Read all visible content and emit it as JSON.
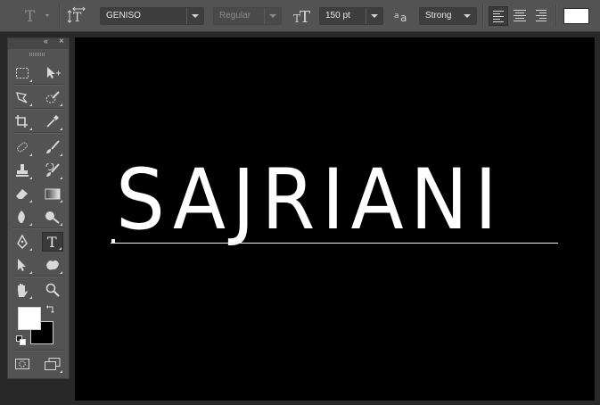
{
  "options_bar": {
    "tool_icon": "type-tool-icon",
    "orientation_icon": "text-orientation-icon",
    "font_family": "GENISO",
    "font_style": "Regular",
    "size_icon": "font-size-icon",
    "font_size": "150 pt",
    "aa_icon": "anti-alias-icon",
    "anti_alias": "Strong",
    "alignment": [
      "left",
      "center",
      "right"
    ],
    "active_alignment": "left",
    "text_color": "#ffffff"
  },
  "tools_panel": {
    "tools": [
      "rectangular-marquee-icon",
      "move-icon",
      "lasso-icon",
      "quick-selection-icon",
      "crop-icon",
      "eyedropper-icon",
      "healing-brush-icon",
      "brush-icon",
      "clone-stamp-icon",
      "history-brush-icon",
      "eraser-icon",
      "gradient-icon",
      "blur-icon",
      "dodge-icon",
      "pen-icon",
      "type-icon",
      "path-selection-icon",
      "custom-shape-icon",
      "hand-icon",
      "zoom-icon"
    ],
    "selected_tool": "type-icon",
    "foreground_color": "#ffffff",
    "background_color": "#000000"
  },
  "canvas": {
    "text": "SAJRIANI",
    "background": "#000000"
  }
}
